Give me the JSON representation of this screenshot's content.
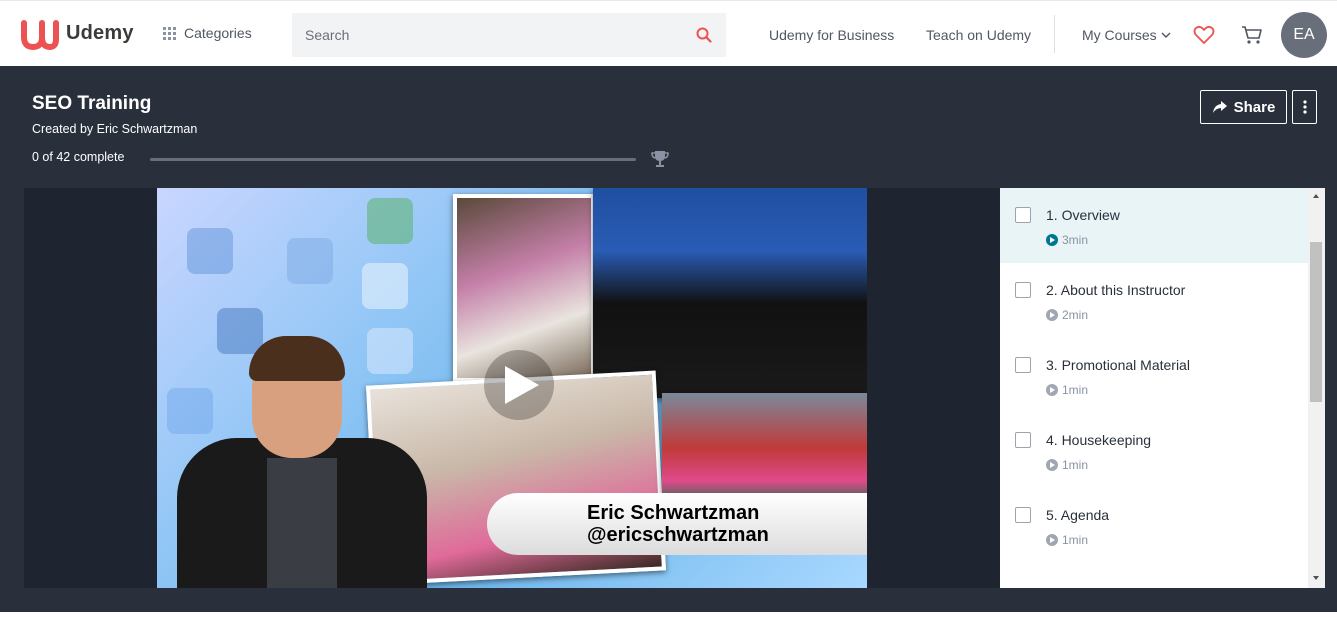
{
  "header": {
    "brand": "Udemy",
    "categories_label": "Categories",
    "search_placeholder": "Search",
    "business_link": "Udemy for Business",
    "teach_link": "Teach on Udemy",
    "my_courses": "My Courses",
    "avatar_initials": "EA",
    "brand_color": "#ec5252"
  },
  "course": {
    "title": "SEO Training",
    "creator": "Created by Eric Schwartzman",
    "progress_text": "0 of 42 complete",
    "progress_fraction": 0,
    "share_label": "Share"
  },
  "video": {
    "lower_third_name": "Eric Schwartzman",
    "lower_third_handle": "@ericschwartzman"
  },
  "lectures": [
    {
      "title": "1. Overview",
      "duration": "3min"
    },
    {
      "title": "2. About this Instructor",
      "duration": "2min"
    },
    {
      "title": "3. Promotional Material",
      "duration": "1min"
    },
    {
      "title": "4. Housekeeping",
      "duration": "1min"
    },
    {
      "title": "5. Agenda",
      "duration": "1min"
    }
  ]
}
